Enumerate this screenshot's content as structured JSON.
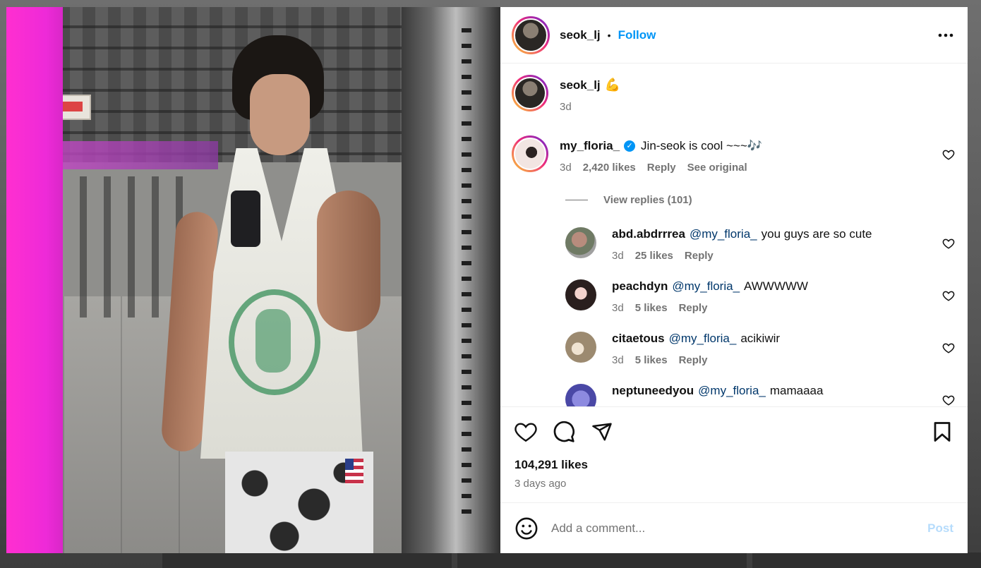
{
  "header": {
    "username": "seok_lj",
    "separator": "•",
    "follow_label": "Follow",
    "more_label": "•••"
  },
  "caption": {
    "username": "seok_lj",
    "emoji": "💪",
    "time": "3d"
  },
  "top_comment": {
    "username": "my_floria_",
    "verified_mark": "✓",
    "text": "Jin-seok is cool ~~~🎶",
    "time": "3d",
    "likes": "2,420 likes",
    "reply_label": "Reply",
    "see_original_label": "See original",
    "view_replies_label": "View replies (101)"
  },
  "replies": [
    {
      "username": "abd.abdrrrea",
      "mention": "@my_floria_",
      "text": "you guys are so cute",
      "time": "3d",
      "likes": "25 likes",
      "reply_label": "Reply"
    },
    {
      "username": "peachdyn",
      "mention": "@my_floria_",
      "text": "AWWWWW",
      "time": "3d",
      "likes": "5 likes",
      "reply_label": "Reply"
    },
    {
      "username": "citaetous",
      "mention": "@my_floria_",
      "text": "acikiwir",
      "time": "3d",
      "likes": "5 likes",
      "reply_label": "Reply"
    },
    {
      "username": "neptuneedyou",
      "mention": "@my_floria_",
      "text": "mamaaaa",
      "time": "",
      "likes": "",
      "reply_label": ""
    }
  ],
  "actions": {
    "likes_count": "104,291 likes",
    "timestamp": "3 days ago"
  },
  "comment_box": {
    "placeholder": "Add a comment...",
    "post_label": "Post"
  },
  "colors": {
    "accent": "#0095f6",
    "post_disabled": "#b6dcfc",
    "muted_text": "#737373",
    "mention": "#00376b"
  }
}
